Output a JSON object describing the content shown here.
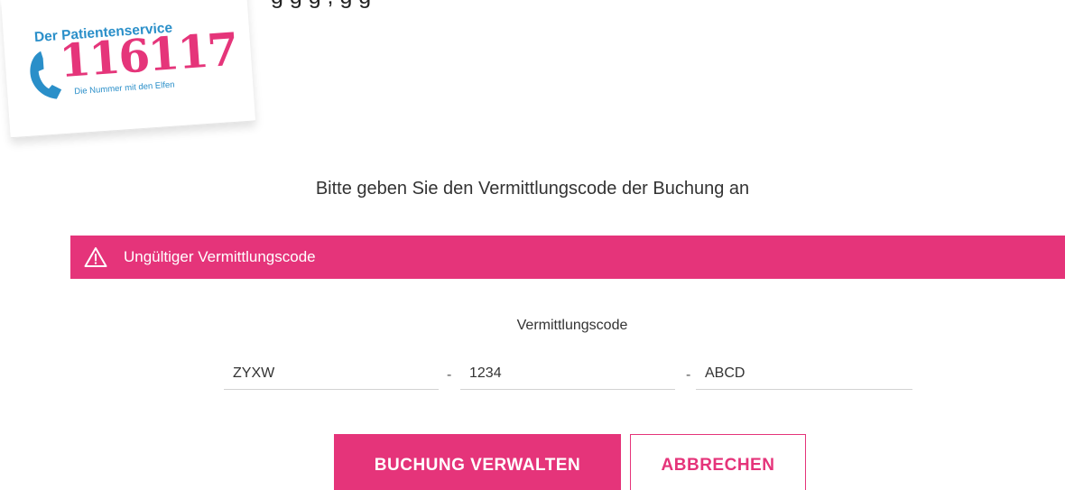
{
  "page": {
    "top_fragment": "g     g     g    ,             g     g"
  },
  "logo": {
    "line1": "Der Patientenservice",
    "number": "116117",
    "line2": "Die Nummer mit den Elfen"
  },
  "instruction": "Bitte geben Sie den Vermittlungscode der Buchung an",
  "error": {
    "icon": "warning-icon",
    "message": "Ungültiger Vermittlungscode",
    "color": "#e5347a"
  },
  "form": {
    "label": "Vermittlungscode",
    "separator": "-",
    "fields": [
      {
        "value": "ZYXW"
      },
      {
        "value": "1234"
      },
      {
        "value": "ABCD"
      }
    ]
  },
  "actions": {
    "primary_label": "BUCHUNG VERWALTEN",
    "secondary_label": "ABBRECHEN"
  },
  "colors": {
    "brand_pink": "#e5347a",
    "brand_blue": "#2a8fc9"
  }
}
